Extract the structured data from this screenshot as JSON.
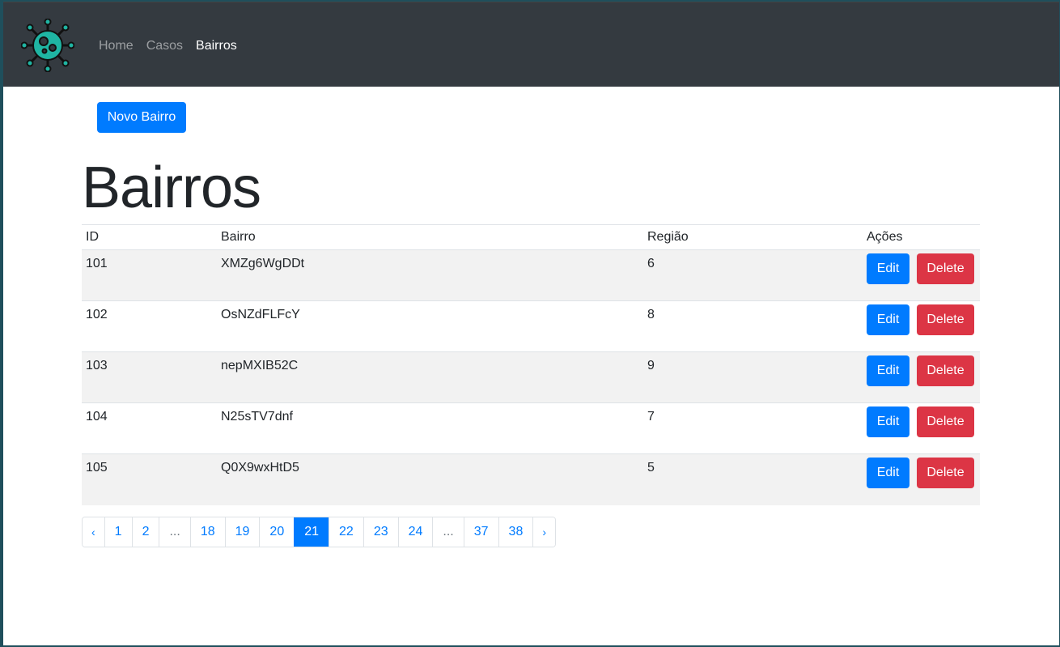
{
  "navbar": {
    "logo_icon": "virus-icon",
    "links": [
      {
        "label": "Home",
        "active": false
      },
      {
        "label": "Casos",
        "active": false
      },
      {
        "label": "Bairros",
        "active": true
      }
    ]
  },
  "actions": {
    "new_label": "Novo Bairro"
  },
  "page": {
    "title": "Bairros"
  },
  "table": {
    "headers": {
      "id": "ID",
      "bairro": "Bairro",
      "regiao": "Região",
      "acoes": "Ações"
    },
    "edit_label": "Edit",
    "delete_label": "Delete",
    "rows": [
      {
        "id": "101",
        "bairro": "XMZg6WgDDt",
        "regiao": "6"
      },
      {
        "id": "102",
        "bairro": "OsNZdFLFcY",
        "regiao": "8"
      },
      {
        "id": "103",
        "bairro": "nepMXIB52C",
        "regiao": "9"
      },
      {
        "id": "104",
        "bairro": "N25sTV7dnf",
        "regiao": "7"
      },
      {
        "id": "105",
        "bairro": "Q0X9wxHtD5",
        "regiao": "5"
      }
    ]
  },
  "pagination": {
    "prev": "‹",
    "next": "›",
    "ellipsis": "...",
    "pages": [
      "1",
      "2",
      "...",
      "18",
      "19",
      "20",
      "21",
      "22",
      "23",
      "24",
      "...",
      "37",
      "38"
    ],
    "current": "21"
  },
  "colors": {
    "navbar_bg": "#343a40",
    "primary": "#007bff",
    "danger": "#dc3545",
    "logo_teal": "#1fb5a3"
  }
}
